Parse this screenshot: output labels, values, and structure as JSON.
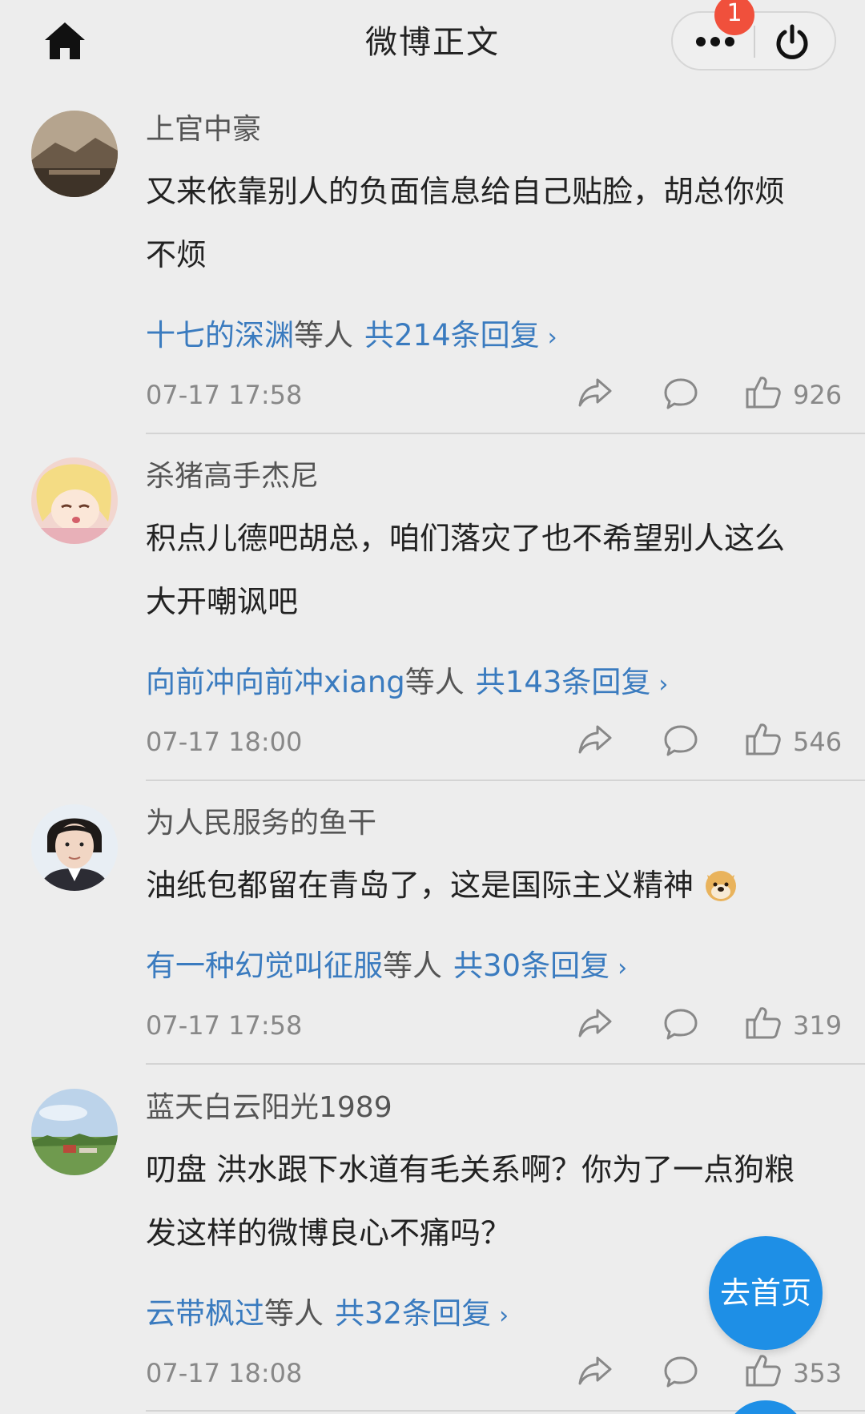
{
  "header": {
    "title": "微博正文",
    "notification_count": "1"
  },
  "colors": {
    "link_blue": "#3a7bbf",
    "background": "#ededed",
    "badge_red": "#f0503c",
    "fab_blue": "#1e8fe6"
  },
  "comments": [
    {
      "username": "上官中豪",
      "content_line1": "又来依靠别人的负面信息给自己贴脸，胡总你烦",
      "content_line2": "不烦",
      "reply_users": "十七的深渊",
      "reply_suffix": "等人",
      "reply_count": "共214条回复",
      "time": "07-17 17:58",
      "likes": "926"
    },
    {
      "username": "杀猪高手杰尼",
      "content_line1": "积点儿德吧胡总，咱们落灾了也不希望别人这么",
      "content_line2": "大开嘲讽吧",
      "reply_users": "向前冲向前冲xiang",
      "reply_suffix": "等人",
      "reply_count": "共143条回复",
      "time": "07-17 18:00",
      "likes": "546"
    },
    {
      "username": "为人民服务的鱼干",
      "content_line1": "油纸包都留在青岛了，这是国际主义精神",
      "content_line2": "",
      "reply_users": "有一种幻觉叫征服",
      "reply_suffix": "等人",
      "reply_count": "共30条回复",
      "time": "07-17 17:58",
      "likes": "319"
    },
    {
      "username": "蓝天白云阳光1989",
      "content_line1": "叨盘 洪水跟下水道有毛关系啊？你为了一点狗粮",
      "content_line2": "发这样的微博良心不痛吗？",
      "reply_users": "云带枫过",
      "reply_suffix": "等人",
      "reply_count": "共32条回复",
      "time": "07-17 18:08",
      "likes": "353"
    }
  ],
  "reply_chevron": "›",
  "fab_label": "去首页"
}
